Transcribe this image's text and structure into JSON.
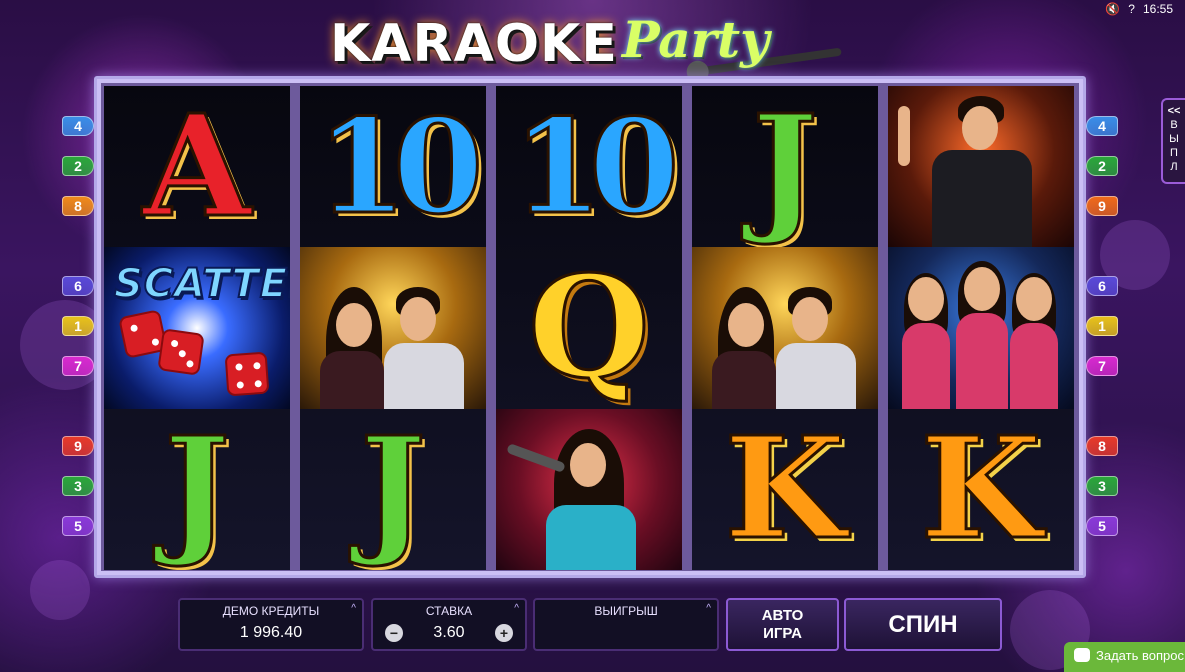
{
  "system": {
    "volume_icon": "speaker-mute-icon",
    "help_glyph": "?",
    "time": "16:55"
  },
  "logo": {
    "word1": "KARAOKE",
    "word2": "Party"
  },
  "reels": [
    [
      {
        "type": "letter",
        "text": "A",
        "kind": "A"
      },
      {
        "type": "picture",
        "name": "scatter",
        "text": "SCATTER"
      },
      {
        "type": "letter",
        "text": "J",
        "kind": "J"
      }
    ],
    [
      {
        "type": "letter",
        "text": "10",
        "kind": "10"
      },
      {
        "type": "picture",
        "name": "couple"
      },
      {
        "type": "letter",
        "text": "J",
        "kind": "J"
      }
    ],
    [
      {
        "type": "letter",
        "text": "10",
        "kind": "10"
      },
      {
        "type": "letter",
        "text": "Q",
        "kind": "Q"
      },
      {
        "type": "picture",
        "name": "girl-singer"
      }
    ],
    [
      {
        "type": "letter",
        "text": "J",
        "kind": "J"
      },
      {
        "type": "picture",
        "name": "couple"
      },
      {
        "type": "letter",
        "text": "K",
        "kind": "K"
      }
    ],
    [
      {
        "type": "picture",
        "name": "male-singer"
      },
      {
        "type": "picture",
        "name": "party-girls"
      },
      {
        "type": "letter",
        "text": "K",
        "kind": "K"
      }
    ]
  ],
  "paylines": {
    "left": [
      {
        "n": "4",
        "color": "#3a8ee8"
      },
      {
        "n": "2",
        "color": "#2aa83a"
      },
      {
        "n": "8",
        "color": "#f08a1a"
      },
      {
        "n": "6",
        "color": "#5a4ad8"
      },
      {
        "n": "1",
        "color": "#e8c21a"
      },
      {
        "n": "7",
        "color": "#d82ad0"
      },
      {
        "n": "9",
        "color": "#e83a2a"
      },
      {
        "n": "3",
        "color": "#2aa83a"
      },
      {
        "n": "5",
        "color": "#8a3ad8"
      }
    ],
    "right": [
      {
        "n": "4",
        "color": "#3a8ee8"
      },
      {
        "n": "2",
        "color": "#2aa83a"
      },
      {
        "n": "9",
        "color": "#f06a1a"
      },
      {
        "n": "6",
        "color": "#5a4ad8"
      },
      {
        "n": "1",
        "color": "#e8c21a"
      },
      {
        "n": "7",
        "color": "#d82ad0"
      },
      {
        "n": "8",
        "color": "#e83a2a"
      },
      {
        "n": "3",
        "color": "#2aa83a"
      },
      {
        "n": "5",
        "color": "#8a3ad8"
      }
    ]
  },
  "side_tab": {
    "arrow": "<<",
    "letters": [
      "В",
      "Ы",
      "П",
      "Л"
    ]
  },
  "controls": {
    "credits_label": "ДЕМО КРЕДИТЫ",
    "credits_value": "1 996.40",
    "bet_label": "СТАВКА",
    "bet_value": "3.60",
    "bet_minus": "−",
    "bet_plus": "+",
    "win_label": "ВЫИГРЫШ",
    "win_value": "",
    "auto_line1": "АВТО",
    "auto_line2": "ИГРА",
    "spin_label": "СПИН",
    "panel_arrow": "^"
  },
  "help": {
    "label": "Задать вопрос"
  }
}
